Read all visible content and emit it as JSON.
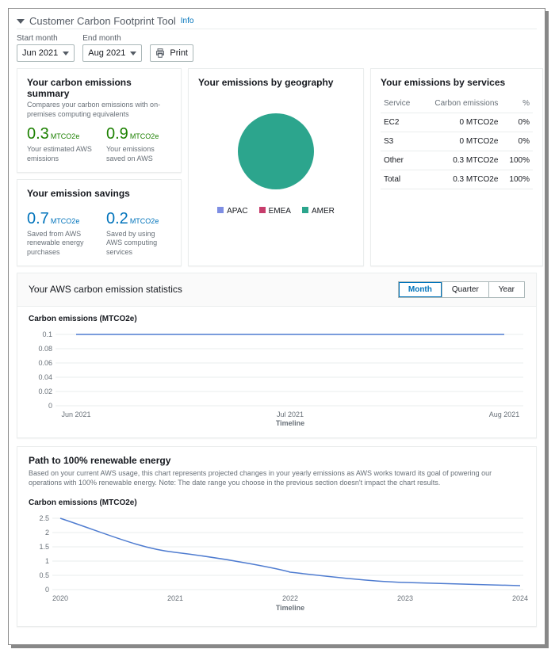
{
  "header": {
    "title": "Customer Carbon Footprint Tool",
    "info": "Info"
  },
  "controls": {
    "start_label": "Start month",
    "end_label": "End month",
    "start_value": "Jun 2021",
    "end_value": "Aug 2021",
    "print_label": "Print"
  },
  "summary": {
    "title": "Your carbon emissions summary",
    "subtitle": "Compares your carbon emissions with on-premises computing equivalents",
    "estimated_val": "0.3",
    "estimated_unit": "MTCO2e",
    "estimated_desc": "Your estimated AWS emissions",
    "saved_val": "0.9",
    "saved_unit": "MTCO2e",
    "saved_desc": "Your emissions saved on AWS"
  },
  "savings": {
    "title": "Your emission savings",
    "renewable_val": "0.7",
    "renewable_unit": "MTCO2e",
    "renewable_desc": "Saved from AWS renewable energy purchases",
    "compute_val": "0.2",
    "compute_unit": "MTCO2e",
    "compute_desc": "Saved by using AWS computing services"
  },
  "geography": {
    "title": "Your emissions by geography",
    "legend": {
      "apac": "APAC",
      "emea": "EMEA",
      "amer": "AMER"
    }
  },
  "services": {
    "title": "Your emissions by services",
    "cols": [
      "Service",
      "Carbon emissions",
      "%"
    ],
    "rows": [
      {
        "name": "EC2",
        "emissions": "0 MTCO2e",
        "pct": "0%"
      },
      {
        "name": "S3",
        "emissions": "0 MTCO2e",
        "pct": "0%"
      },
      {
        "name": "Other",
        "emissions": "0.3 MTCO2e",
        "pct": "100%"
      },
      {
        "name": "Total",
        "emissions": "0.3 MTCO2e",
        "pct": "100%"
      }
    ]
  },
  "stats": {
    "title": "Your AWS carbon emission statistics",
    "tabs": {
      "month": "Month",
      "quarter": "Quarter",
      "year": "Year"
    },
    "chart_title": "Carbon emissions (MTCO2e)",
    "xlabel": "Timeline"
  },
  "path": {
    "title": "Path to 100% renewable energy",
    "desc": "Based on your current AWS usage, this chart represents projected changes in your yearly emissions as AWS works toward its goal of powering our operations with 100% renewable energy. Note: The date range you choose in the previous section doesn't impact the chart results.",
    "chart_title": "Carbon emissions (MTCO2e)",
    "xlabel": "Timeline"
  },
  "chart_data": [
    {
      "type": "line",
      "title": "Carbon emissions (MTCO2e)",
      "xlabel": "Timeline",
      "ylabel": "",
      "ylim": [
        0,
        0.1
      ],
      "yticks": [
        0,
        0.02,
        0.04,
        0.06,
        0.08,
        0.1
      ],
      "categories": [
        "Jun 2021",
        "Jul 2021",
        "Aug 2021"
      ],
      "values": [
        0.1,
        0.1,
        0.1
      ]
    },
    {
      "type": "line",
      "title": "Path to 100% renewable energy — Carbon emissions (MTCO2e)",
      "xlabel": "Timeline",
      "ylabel": "",
      "ylim": [
        0,
        2.5
      ],
      "yticks": [
        0,
        0.5,
        1,
        1.5,
        2,
        2.5
      ],
      "categories": [
        "2020",
        "2021",
        "2022",
        "2023",
        "2024"
      ],
      "values": [
        2.5,
        1.3,
        0.6,
        0.25,
        0.15
      ]
    },
    {
      "type": "pie",
      "title": "Your emissions by geography",
      "series": [
        {
          "name": "APAC",
          "value": 0
        },
        {
          "name": "EMEA",
          "value": 0
        },
        {
          "name": "AMER",
          "value": 0.3
        }
      ]
    }
  ]
}
